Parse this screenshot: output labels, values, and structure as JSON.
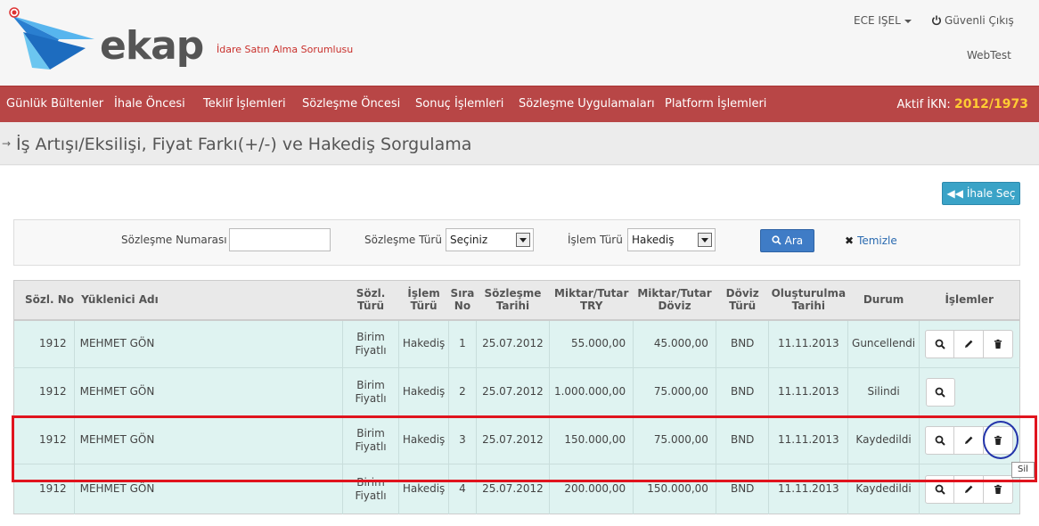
{
  "header": {
    "brand": "ekap",
    "subtitle": "İdare Satın Alma Sorumlusu",
    "user": "ECE IŞEL",
    "logout": "Güvenli Çıkış",
    "env": "WebTest"
  },
  "nav": {
    "items": [
      "Günlük Bültenler",
      "İhale Öncesi",
      "Teklif İşlemleri",
      "Sözleşme Öncesi",
      "Sonuç İşlemleri",
      "Sözleşme Uygulamaları",
      "Platform İşlemleri"
    ],
    "ikn_label": "Aktif İKN:",
    "ikn_value": "2012/1973"
  },
  "page": {
    "title": "İş Artışı/Eksilişi, Fiyat Farkı(+/-) ve Hakediş Sorgulama",
    "ihale_sec": "İhale Seç"
  },
  "filter": {
    "contract_no_label": "Sözleşme Numarası",
    "contract_no_value": "",
    "contract_type_label": "Sözleşme Türü",
    "contract_type_value": "Seçiniz",
    "op_type_label": "İşlem Türü",
    "op_type_value": "Hakediş",
    "search_label": "Ara",
    "clear_label": "Temizle"
  },
  "table": {
    "headers": [
      "Sözl. No",
      "Yüklenici Adı",
      "Sözl. Türü",
      "İşlem Türü",
      "Sıra No",
      "Sözleşme Tarihi",
      "Miktar/Tutar TRY",
      "Miktar/Tutar Döviz",
      "Döviz Türü",
      "Oluşturulma Tarihi",
      "Durum",
      "İşlemler"
    ],
    "rows": [
      {
        "no": "1912",
        "name": "MEHMET GÖN",
        "type": "Birim Fiyatlı",
        "op": "Hakediş",
        "seq": "1",
        "date": "25.07.2012",
        "try": "55.000,00",
        "fx": "45.000,00",
        "cur": "BND",
        "created": "11.11.2013",
        "status": "Guncellendi"
      },
      {
        "no": "1912",
        "name": "MEHMET GÖN",
        "type": "Birim Fiyatlı",
        "op": "Hakediş",
        "seq": "2",
        "date": "25.07.2012",
        "try": "1.000.000,00",
        "fx": "75.000,00",
        "cur": "BND",
        "created": "11.11.2013",
        "status": "Silindi"
      },
      {
        "no": "1912",
        "name": "MEHMET GÖN",
        "type": "Birim Fiyatlı",
        "op": "Hakediş",
        "seq": "3",
        "date": "25.07.2012",
        "try": "150.000,00",
        "fx": "75.000,00",
        "cur": "BND",
        "created": "11.11.2013",
        "status": "Kaydedildi"
      },
      {
        "no": "1912",
        "name": "MEHMET GÖN",
        "type": "Birim Fiyatlı",
        "op": "Hakediş",
        "seq": "4",
        "date": "25.07.2012",
        "try": "200.000,00",
        "fx": "150.000,00",
        "cur": "BND",
        "created": "11.11.2013",
        "status": "Kaydedildi"
      }
    ]
  },
  "tooltip": "Sil"
}
